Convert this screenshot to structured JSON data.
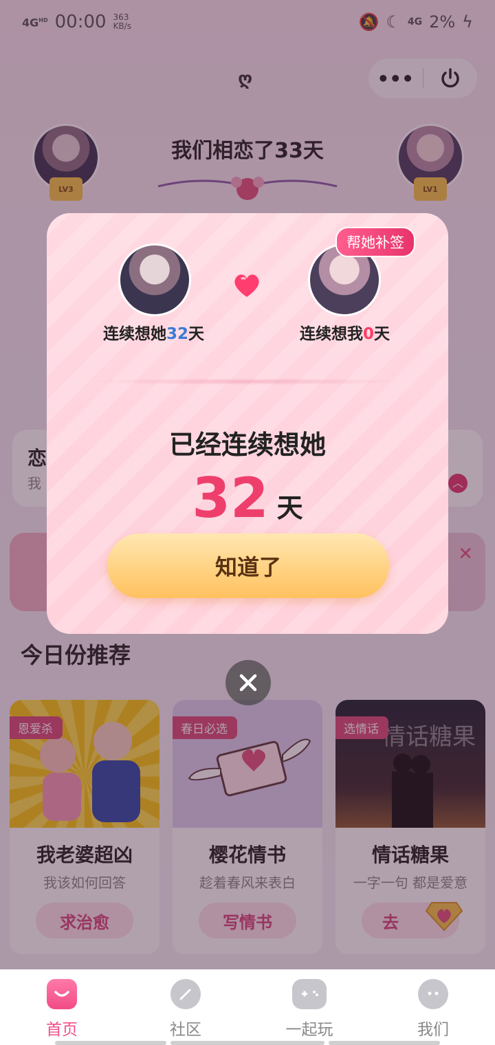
{
  "status_bar": {
    "network": "4G",
    "network_sup": "HD",
    "time": "00:00",
    "speed_value": "363",
    "speed_unit": "KB/s",
    "net2": "4G",
    "battery": "2%"
  },
  "header": {
    "love_days_text": "我们相恋了33天",
    "left_level": "LV3",
    "right_level": "LV1"
  },
  "modal": {
    "help_badge": "帮她补签",
    "left_label_prefix": "连续想她",
    "left_days": "32",
    "left_label_suffix": "天",
    "right_label_prefix": "连续想我",
    "right_days": "0",
    "right_label_suffix": "天",
    "headline": "已经连续想她",
    "count": "32",
    "count_unit": "天",
    "ok_button": "知道了"
  },
  "background_cards": {
    "partial_title": "恋",
    "partial_sub": "我"
  },
  "recommend": {
    "title": "今日份推荐",
    "cards": [
      {
        "tag": "恩爱杀",
        "title": "我老婆超凶",
        "subtitle": "我该如何回答",
        "button": "求治愈"
      },
      {
        "tag": "春日必选",
        "title": "樱花情书",
        "subtitle": "趁着春风来表白",
        "button": "写情书"
      },
      {
        "tag": "选情话",
        "title": "情话糖果",
        "subtitle": "一字一句 都是爱意",
        "button": "去",
        "image_text": "情话糖果"
      }
    ]
  },
  "tabs": [
    {
      "label": "首页",
      "icon": "home-icon",
      "active": true
    },
    {
      "label": "社区",
      "icon": "feather-icon",
      "active": false
    },
    {
      "label": "一起玩",
      "icon": "gamepad-icon",
      "active": false
    },
    {
      "label": "我们",
      "icon": "couple-icon",
      "active": false
    }
  ],
  "colors": {
    "accent_pink": "#f0508a",
    "count_red": "#ee3f6c",
    "days_blue": "#3a7bd5",
    "button_orange": "#ffc160"
  }
}
